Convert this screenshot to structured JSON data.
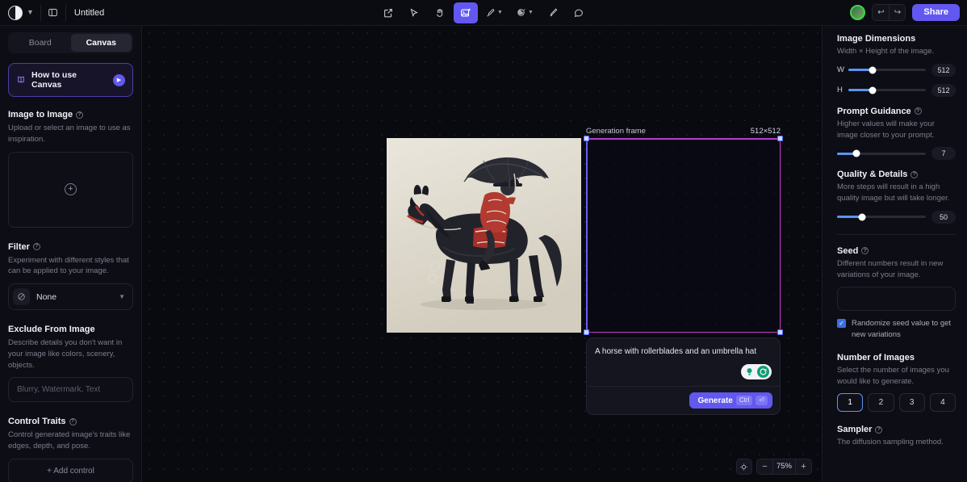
{
  "topbar": {
    "logo_icon": "app-logo-icon",
    "chevron_icon": "chevron-down-icon",
    "panel_toggle_icon": "panel-toggle-icon",
    "document_title": "Untitled",
    "tools": [
      {
        "name": "share-export-icon",
        "glyph": "↗",
        "active": false,
        "caret": false
      },
      {
        "name": "cursor-select-icon",
        "glyph": "➤",
        "active": false,
        "caret": false
      },
      {
        "name": "hand-pan-icon",
        "glyph": "✋",
        "active": false,
        "caret": false
      },
      {
        "name": "image-generate-icon",
        "glyph": "✦",
        "active": true,
        "caret": false
      },
      {
        "name": "brush-icon",
        "glyph": "✎",
        "active": false,
        "caret": true
      },
      {
        "name": "eraser-fill-icon",
        "glyph": "◕",
        "active": false,
        "caret": true
      },
      {
        "name": "pen-icon",
        "glyph": "✐",
        "active": false,
        "caret": false
      },
      {
        "name": "comment-icon",
        "glyph": "◯",
        "active": false,
        "caret": false
      }
    ],
    "avatar_label": "",
    "undo_icon": "undo-icon",
    "redo_icon": "redo-icon",
    "share_label": "Share"
  },
  "left_panel": {
    "tabs": [
      {
        "label": "Board",
        "active": false
      },
      {
        "label": "Canvas",
        "active": true
      }
    ],
    "howto": {
      "icon": "book-icon",
      "label": "How to use Canvas",
      "play_icon": "play-icon"
    },
    "image_to_image": {
      "title": "Image to Image",
      "info_icon": "info-icon",
      "description": "Upload or select an image to use as inspiration.",
      "upload_icon": "plus-circle-icon"
    },
    "filter": {
      "title": "Filter",
      "info_icon": "info-icon",
      "description": "Experiment with different styles that can be applied to your image.",
      "selected": "None",
      "option_icon": "no-filter-icon",
      "caret_icon": "chevron-down-icon"
    },
    "exclude": {
      "title": "Exclude From Image",
      "description": "Describe details you don't want in your image like colors, scenery, objects.",
      "placeholder": "Blurry, Watermark, Text",
      "value": ""
    },
    "control_traits": {
      "title": "Control Traits",
      "info_icon": "info-icon",
      "description": "Control generated image's traits like edges, depth, and pose.",
      "add_label": "+ Add control"
    }
  },
  "canvas": {
    "frame_label": "Generation frame",
    "frame_size": "512×512",
    "artwork_alt": "A horse with rollerblades and an umbrella hat",
    "prompt": {
      "text": "A horse with rollerblades and an umbrella hat",
      "idea_icon": "lightbulb-icon",
      "refresh_icon": "refresh-icon",
      "generate_label": "Generate",
      "shortcut_modifier": "Ctrl",
      "shortcut_key": "⏎"
    },
    "zoom": {
      "fit_icon": "fit-to-screen-icon",
      "minus_label": "−",
      "value": "75%",
      "plus_label": "+"
    }
  },
  "right_panel": {
    "image_dimensions": {
      "title": "Image Dimensions",
      "description": "Width × Height of the image.",
      "width_label": "W",
      "width_value": "512",
      "width_percent": 31,
      "height_label": "H",
      "height_value": "512",
      "height_percent": 31
    },
    "prompt_guidance": {
      "title": "Prompt Guidance",
      "info_icon": "info-icon",
      "description": "Higher values will make your image closer to your prompt.",
      "value": "7",
      "percent": 22
    },
    "quality_details": {
      "title": "Quality & Details",
      "info_icon": "info-icon",
      "description": "More steps will result in a high quality image but will take longer.",
      "value": "50",
      "percent": 28
    },
    "seed": {
      "title": "Seed",
      "info_icon": "info-icon",
      "description": "Different numbers result in new variations of your image.",
      "value": "",
      "randomize_label": "Randomize seed value to get new variations",
      "randomize_checked": true,
      "check_icon": "check-icon"
    },
    "number_of_images": {
      "title": "Number of Images",
      "description": "Select the number of images you would like to generate.",
      "options": [
        "1",
        "2",
        "3",
        "4"
      ],
      "selected": "1"
    },
    "sampler": {
      "title": "Sampler",
      "info_icon": "info-icon",
      "description": "The diffusion sampling method."
    }
  },
  "colors": {
    "accent": "#6258f0",
    "slider": "#5d94f0",
    "frame_pink": "#c838c8",
    "frame_blue": "#6b5bf5",
    "green": "#0f9d74"
  }
}
